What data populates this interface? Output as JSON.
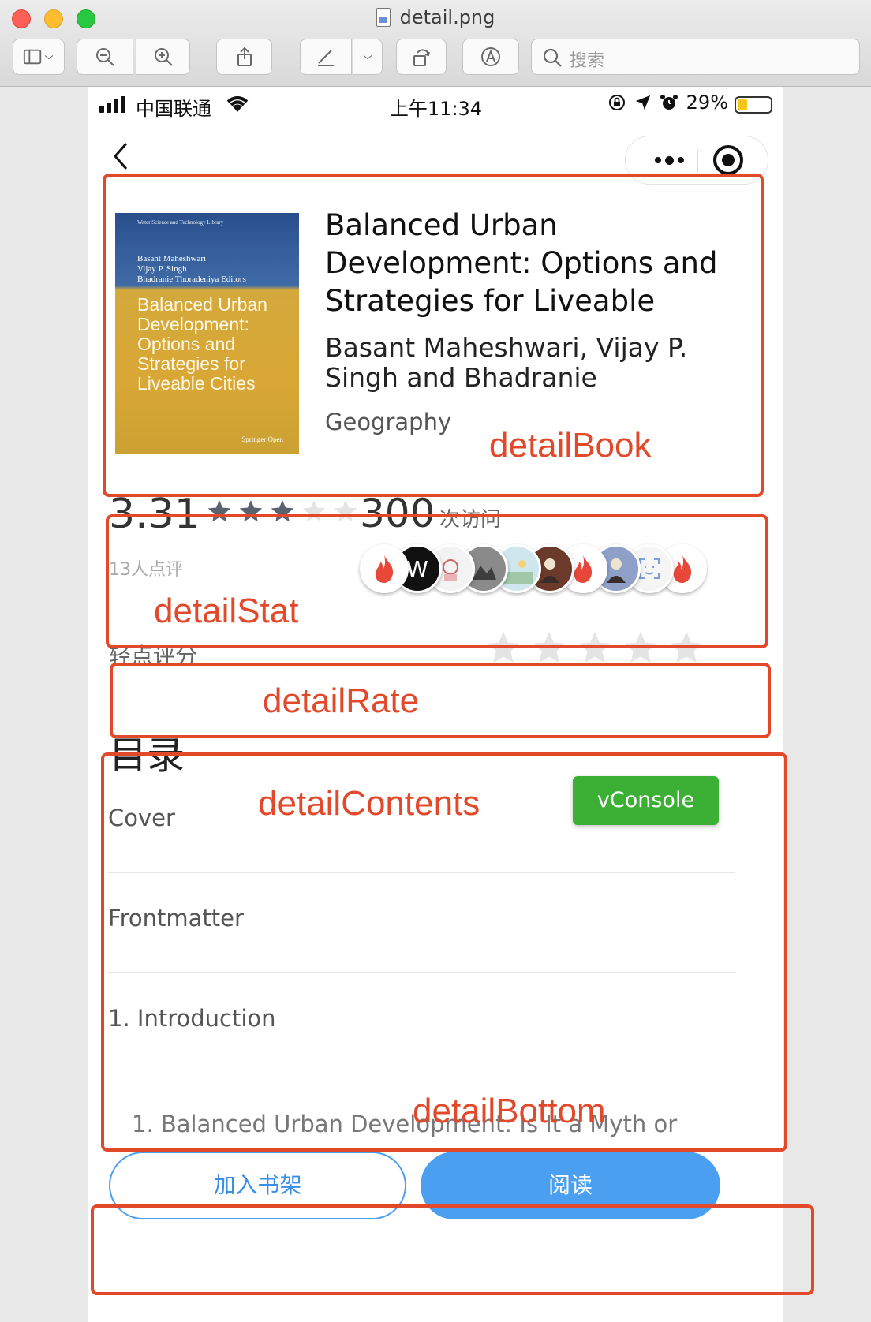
{
  "window": {
    "title": "detail.png",
    "search_placeholder": "搜索",
    "toolbar_icons": [
      "sidebar-icon",
      "chevron-down-icon",
      "zoom-out-icon",
      "zoom-in-icon",
      "share-icon",
      "markup-pen-icon",
      "chevron-down-icon",
      "rotate-icon",
      "annotate-icon",
      "search-icon"
    ]
  },
  "statusbar": {
    "carrier": "中国联通",
    "time": "上午11:34",
    "battery": "29%",
    "battery_level": 0.29
  },
  "book": {
    "cover": {
      "series": "Water Science and Technology Library",
      "authors": "Basant Maheshwari\nVijay P. Singh\nBhadranie Thoradeniya  Editors",
      "title": "Balanced Urban\nDevelopment:\nOptions and\nStrategies for\nLiveable Cities",
      "publisher": "Springer Open"
    },
    "title": "Balanced Urban Development: Options and Strategies for Liveable",
    "authors": "Basant Maheshwari, Vijay P. Singh and Bhadranie",
    "category": "Geography"
  },
  "stats": {
    "score": "3.31",
    "score_stars": 3,
    "visits": "300",
    "visits_label": "次访问",
    "review_count": "13人点评"
  },
  "rate": {
    "label": "轻点评分",
    "stars_total": 5,
    "stars_selected": 0
  },
  "contents": {
    "title": "目录",
    "items": [
      "Cover",
      "Frontmatter",
      "1. Introduction"
    ],
    "partial_item": "1. Balanced Urban Development: Is It a Myth or"
  },
  "vconsole": {
    "label": "vConsole"
  },
  "actions": {
    "add_shelf": "加入书架",
    "read": "阅读"
  },
  "annotations": {
    "detail_book": "detailBook",
    "detail_stat": "detailStat",
    "detail_rate": "detailRate",
    "detail_contents": "detailContents",
    "detail_bottom": "detailBottom"
  },
  "colors": {
    "annotation": "#e2492b",
    "primary_blue": "#4a9ff0",
    "vconsole_green": "#3cb035",
    "star_filled": "#5a6270",
    "star_empty": "#e4e4e4"
  }
}
